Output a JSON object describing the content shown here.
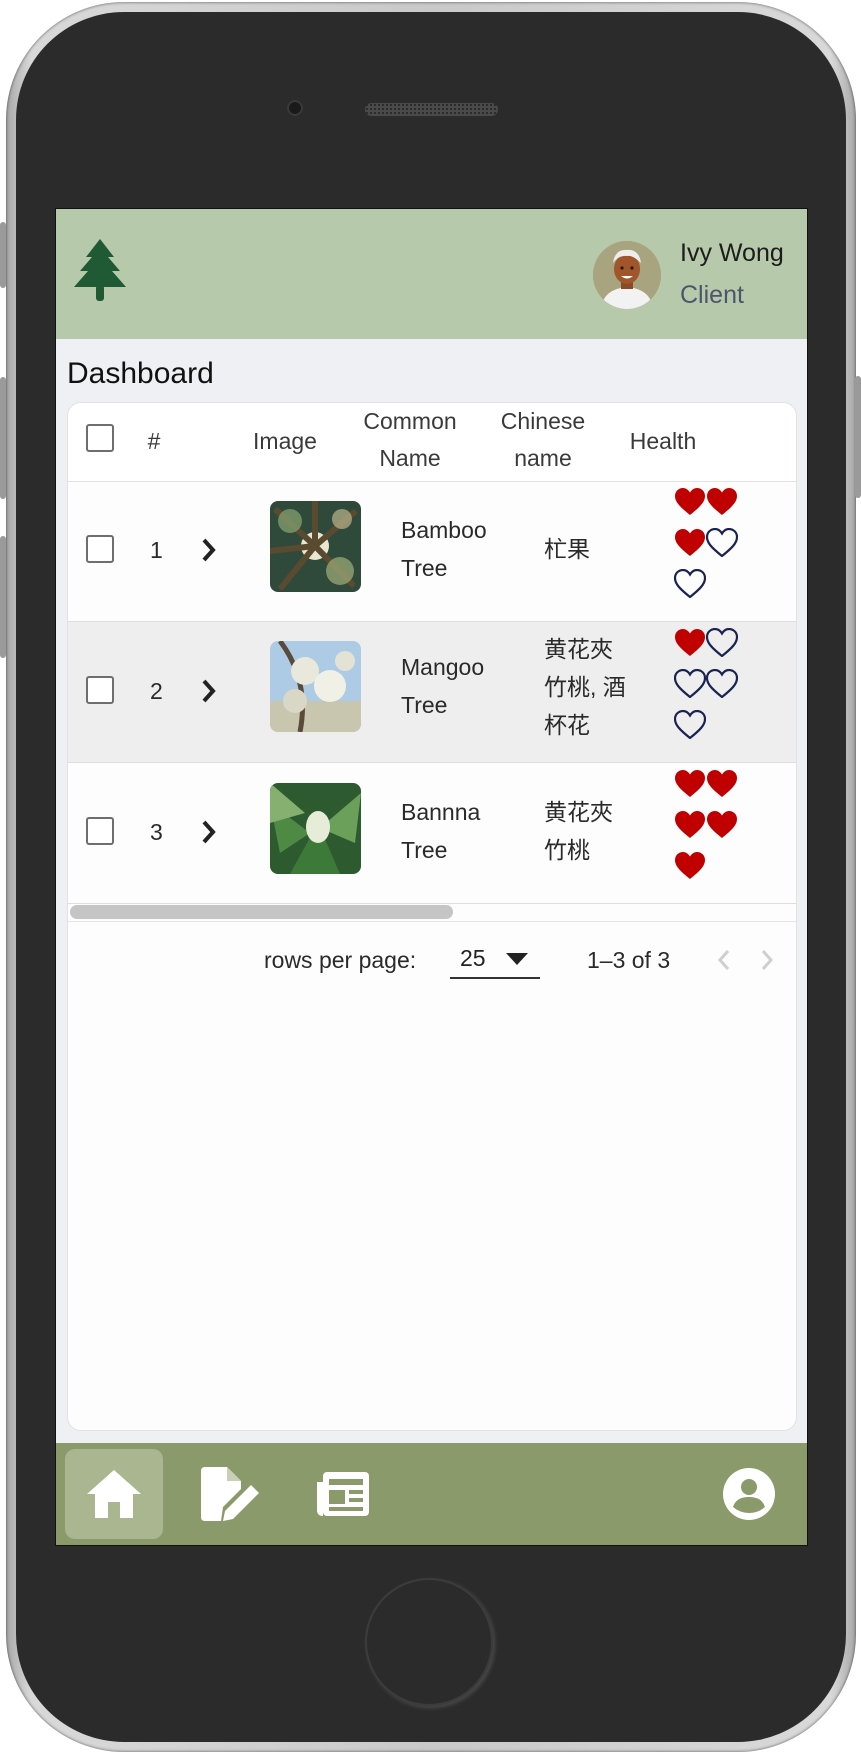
{
  "header": {
    "logo_icon": "tree-icon",
    "user": {
      "name": "Ivy Wong",
      "role": "Client"
    }
  },
  "page": {
    "title": "Dashboard"
  },
  "table": {
    "columns": {
      "index": "#",
      "image": "Image",
      "common_name_1": "Common",
      "common_name_2": "Name",
      "chinese_name_1": "Chinese",
      "chinese_name_2": "name",
      "health": "Health"
    },
    "rows": [
      {
        "index": "1",
        "common_1": "Bamboo",
        "common_2": "Tree",
        "chinese_lines": [
          "杧果",
          "",
          ""
        ],
        "health": 3,
        "health_max": 5
      },
      {
        "index": "2",
        "common_1": "Mangoo",
        "common_2": "Tree",
        "chinese_lines": [
          "黄花夾",
          "竹桃, 酒",
          "杯花"
        ],
        "health": 1,
        "health_max": 5
      },
      {
        "index": "3",
        "common_1": "Bannna",
        "common_2": "Tree",
        "chinese_lines": [
          "黄花夾",
          "竹桃",
          ""
        ],
        "health": 5,
        "health_max": 5
      }
    ]
  },
  "pagination": {
    "rows_per_page_label": "rows per page:",
    "rows_per_page_value": "25",
    "range": "1–3 of 3"
  },
  "bottom_nav": {
    "items": [
      "home-icon",
      "edit-document-icon",
      "newspaper-icon",
      "account-icon"
    ],
    "active": "home-icon"
  },
  "colors": {
    "header_bg": "#b7c9ab",
    "nav_bg": "#8a9a6a",
    "heart_filled": "#c00000",
    "heart_outline": "#1a2350",
    "logo": "#1f5a35"
  }
}
